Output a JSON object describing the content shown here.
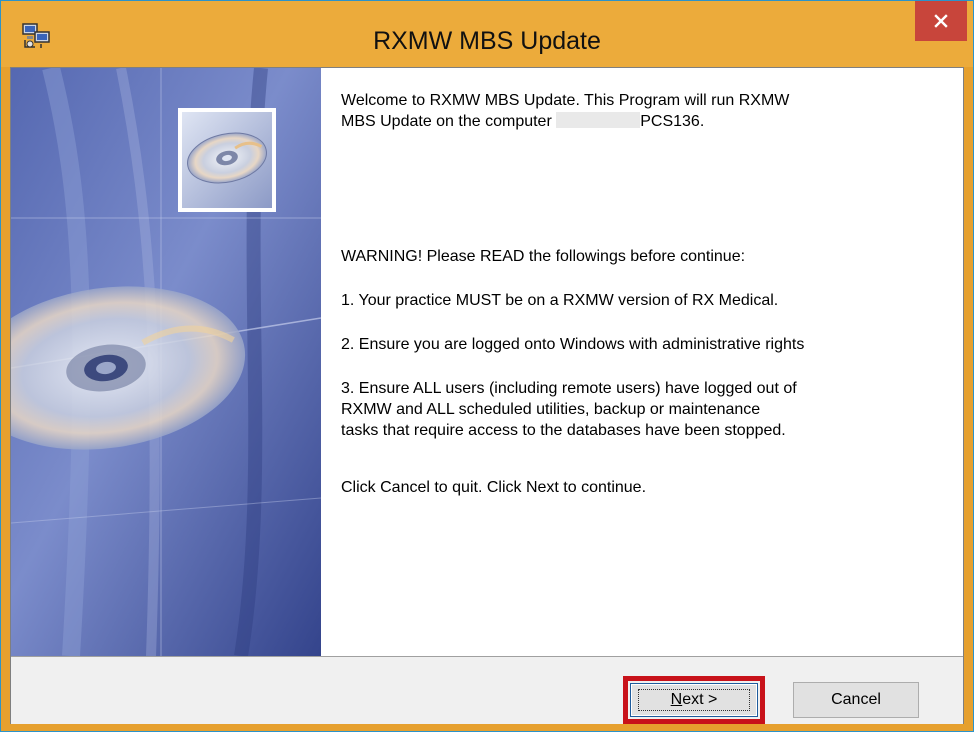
{
  "window": {
    "title": "RXMW MBS Update",
    "close_label": "×"
  },
  "content": {
    "welcome_line1": "Welcome to RXMW MBS Update.  This Program will run RXMW",
    "welcome_line2_prefix": "MBS Update on the computer ",
    "welcome_line2_suffix": "PCS136.",
    "warning": "WARNING! Please READ the followings before continue:",
    "item1": "1. Your practice MUST be on a RXMW version of RX Medical.",
    "item2": "2. Ensure you are logged onto Windows with administrative rights",
    "item3": "3. Ensure ALL users (including remote users) have logged out of\nRXMW and ALL scheduled utilities, backup or maintenance\ntasks that require access to the databases have been stopped.",
    "instructions": "Click Cancel to quit.  Click Next to continue."
  },
  "buttons": {
    "next_mnemonic": "N",
    "next_rest": "ext >",
    "cancel": "Cancel"
  },
  "colors": {
    "titlebar": "#ecab3b",
    "close": "#c8453b",
    "highlight": "#c8121a"
  }
}
